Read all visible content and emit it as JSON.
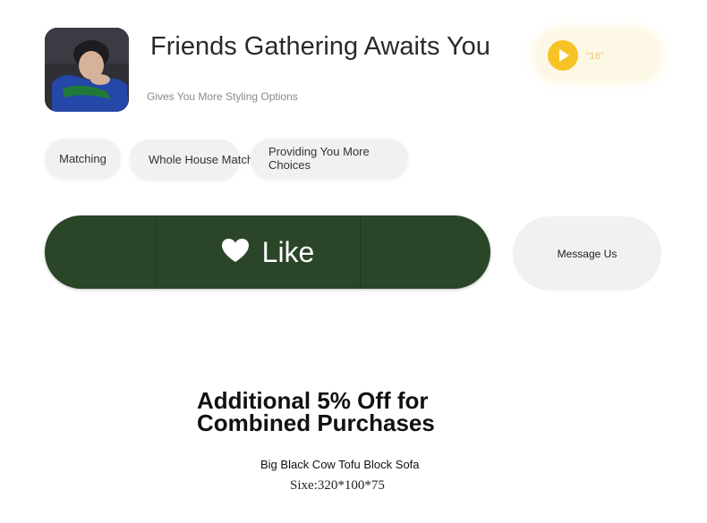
{
  "header": {
    "title": "Friends Gathering Awaits You",
    "subtitle": "Gives You More Styling Options"
  },
  "audio": {
    "duration": "\"16\"",
    "icon": "play-icon",
    "accent": "#f6c427"
  },
  "tags": [
    {
      "label": "Matching"
    },
    {
      "label": "Whole House Matching"
    },
    {
      "label": "Providing You More Choices"
    }
  ],
  "actions": {
    "like_label": "Like",
    "like_icon": "heart-icon",
    "like_color": "#2a4527",
    "message_label": "Message Us"
  },
  "promo": {
    "headline": "Additional 5% Off for Combined Purchases",
    "product_name": "Big Black Cow Tofu Block Sofa",
    "product_size": "Sixe:320*100*75"
  }
}
